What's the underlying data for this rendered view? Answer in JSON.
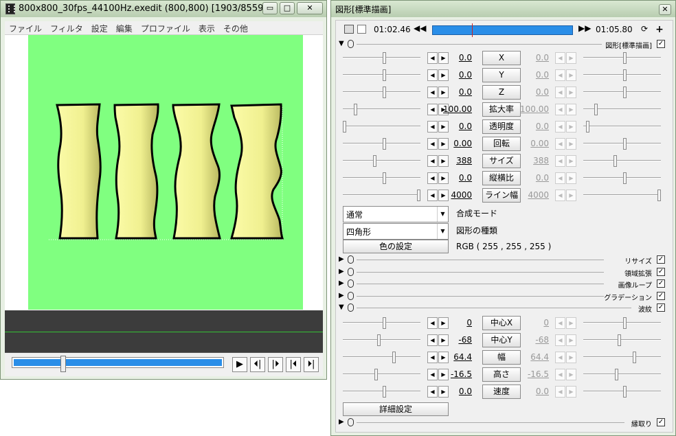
{
  "main_window": {
    "title": "800x800_30fps_44100Hz.exedit (800,800)  [1903/8559...",
    "menu": [
      "ファイル",
      "フィルタ",
      "設定",
      "編集",
      "プロファイル",
      "表示",
      "その他"
    ],
    "window_buttons": [
      "▭",
      "□",
      "✕"
    ]
  },
  "playback": {
    "buttons": [
      "▶",
      "⏴|",
      "|⏵",
      "|⏴",
      "⏵|"
    ],
    "position_fraction": 0.23
  },
  "panel": {
    "title": "図形[標準描画]",
    "close": "✕",
    "toolbar": {
      "start_time": "01:02.46",
      "end_time": "01:05.80",
      "prev": "◀◀",
      "next": "▶▶",
      "cursor_fraction": 0.28
    },
    "section_main": {
      "name": "図形[標準描画]",
      "checked": true
    },
    "params": [
      {
        "label": "X",
        "value": "0.0",
        "end": "0.0"
      },
      {
        "label": "Y",
        "value": "0.0",
        "end": "0.0"
      },
      {
        "label": "Z",
        "value": "0.0",
        "end": "0.0"
      },
      {
        "label": "拡大率",
        "value": "100.00",
        "end": "100.00"
      },
      {
        "label": "透明度",
        "value": "0.0",
        "end": "0.0"
      },
      {
        "label": "回転",
        "value": "0.00",
        "end": "0.00"
      },
      {
        "label": "サイズ",
        "value": "388",
        "end": "388"
      },
      {
        "label": "縦横比",
        "value": "0.0",
        "end": "0.0"
      },
      {
        "label": "ライン幅",
        "value": "4000",
        "end": "4000"
      }
    ],
    "blend_select": "通常",
    "blend_label": "合成モード",
    "shape_select": "四角形",
    "shape_label": "図形の種類",
    "color_button": "色の設定",
    "color_value": "RGB ( 255 , 255 , 255 )",
    "filters": [
      {
        "name": "リサイズ",
        "checked": true
      },
      {
        "name": "領域拡張",
        "checked": true
      },
      {
        "name": "画像ループ",
        "checked": true
      },
      {
        "name": "グラデーション",
        "checked": true
      },
      {
        "name": "波紋",
        "checked": true
      }
    ],
    "ripple_params": [
      {
        "label": "中心X",
        "value": "0",
        "end": "0"
      },
      {
        "label": "中心Y",
        "value": "-68",
        "end": "-68"
      },
      {
        "label": "幅",
        "value": "64.4",
        "end": "64.4"
      },
      {
        "label": "高さ",
        "value": "-16.5",
        "end": "-16.5"
      },
      {
        "label": "速度",
        "value": "0.0",
        "end": "0.0"
      }
    ],
    "detail_button": "詳細設定",
    "border_filter": {
      "name": "縁取り",
      "checked": true
    }
  },
  "colors": {
    "canvas": "#80ff80",
    "shape_fill": "#f6f698",
    "seek": "#2a8ee8"
  }
}
